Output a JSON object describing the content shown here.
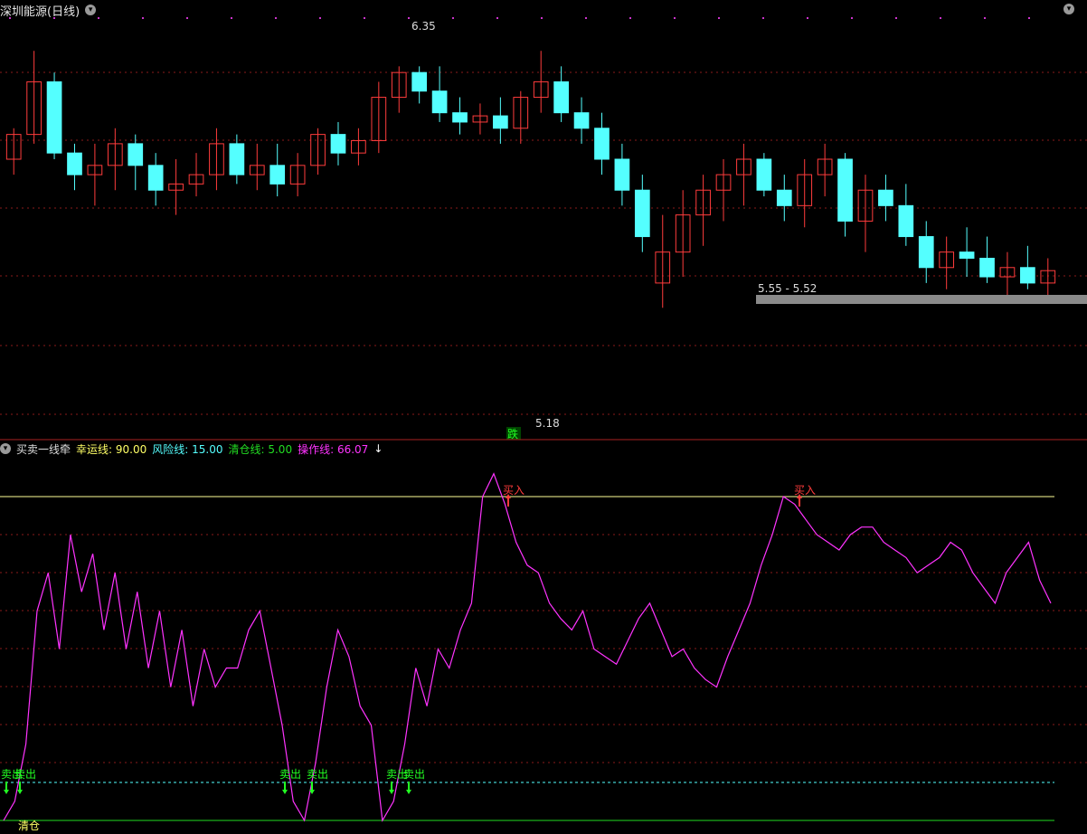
{
  "price_panel": {
    "title": "深圳能源(日线)",
    "high_label": "6.35",
    "low_label": "5.18",
    "zone_label": "5.55 - 5.52",
    "fall_label": "跌"
  },
  "indicator_panel": {
    "name": "买卖一线牵",
    "lucky_label": "幸运线:",
    "lucky_value": "90.00",
    "risk_label": "风险线:",
    "risk_value": "15.00",
    "clear_label": "清仓线:",
    "clear_value": "5.00",
    "op_label": "操作线:",
    "op_value": "66.07",
    "op_arrow": "↓",
    "buy_label": "买入",
    "sell_label": "卖出",
    "clear_signal": "清仓"
  },
  "colors": {
    "up": "#ff3c3c",
    "down": "#54ffff",
    "line": "#ff33ff",
    "lucky": "#ffff66",
    "risk": "#55ffff",
    "clear": "#22dd22",
    "buy": "#ff3c3c",
    "sell": "#22ff22"
  },
  "chart_data": [
    {
      "type": "candlestick",
      "title": "深圳能源(日线)",
      "ylim": [
        5.1,
        6.45
      ],
      "annotations": [
        "6.35",
        "5.18",
        "5.55 - 5.52"
      ],
      "candles": [
        [
          6.0,
          6.1,
          5.95,
          6.08
        ],
        [
          6.08,
          6.35,
          6.05,
          6.25
        ],
        [
          6.25,
          6.28,
          6.0,
          6.02
        ],
        [
          6.02,
          6.05,
          5.9,
          5.95
        ],
        [
          5.95,
          6.05,
          5.85,
          5.98
        ],
        [
          5.98,
          6.1,
          5.9,
          6.05
        ],
        [
          6.05,
          6.08,
          5.9,
          5.98
        ],
        [
          5.98,
          6.02,
          5.85,
          5.9
        ],
        [
          5.9,
          6.0,
          5.82,
          5.92
        ],
        [
          5.92,
          6.02,
          5.88,
          5.95
        ],
        [
          5.95,
          6.1,
          5.9,
          6.05
        ],
        [
          6.05,
          6.08,
          5.92,
          5.95
        ],
        [
          5.95,
          6.05,
          5.9,
          5.98
        ],
        [
          5.98,
          6.05,
          5.88,
          5.92
        ],
        [
          5.92,
          6.02,
          5.88,
          5.98
        ],
        [
          5.98,
          6.1,
          5.95,
          6.08
        ],
        [
          6.08,
          6.12,
          5.98,
          6.02
        ],
        [
          6.02,
          6.1,
          5.98,
          6.06
        ],
        [
          6.06,
          6.25,
          6.02,
          6.2
        ],
        [
          6.2,
          6.3,
          6.15,
          6.28
        ],
        [
          6.28,
          6.3,
          6.18,
          6.22
        ],
        [
          6.22,
          6.3,
          6.12,
          6.15
        ],
        [
          6.15,
          6.2,
          6.08,
          6.12
        ],
        [
          6.12,
          6.18,
          6.08,
          6.14
        ],
        [
          6.14,
          6.2,
          6.05,
          6.1
        ],
        [
          6.1,
          6.22,
          6.05,
          6.2
        ],
        [
          6.2,
          6.35,
          6.15,
          6.25
        ],
        [
          6.25,
          6.3,
          6.12,
          6.15
        ],
        [
          6.15,
          6.2,
          6.05,
          6.1
        ],
        [
          6.1,
          6.15,
          5.95,
          6.0
        ],
        [
          6.0,
          6.05,
          5.85,
          5.9
        ],
        [
          5.9,
          5.95,
          5.7,
          5.75
        ],
        [
          5.6,
          5.82,
          5.52,
          5.7
        ],
        [
          5.7,
          5.9,
          5.62,
          5.82
        ],
        [
          5.82,
          5.95,
          5.72,
          5.9
        ],
        [
          5.9,
          6.0,
          5.8,
          5.95
        ],
        [
          5.95,
          6.05,
          5.85,
          6.0
        ],
        [
          6.0,
          6.02,
          5.88,
          5.9
        ],
        [
          5.9,
          5.95,
          5.8,
          5.85
        ],
        [
          5.85,
          6.0,
          5.78,
          5.95
        ],
        [
          5.95,
          6.05,
          5.88,
          6.0
        ],
        [
          6.0,
          6.02,
          5.75,
          5.8
        ],
        [
          5.8,
          5.95,
          5.7,
          5.9
        ],
        [
          5.9,
          5.95,
          5.8,
          5.85
        ],
        [
          5.85,
          5.92,
          5.72,
          5.75
        ],
        [
          5.75,
          5.8,
          5.6,
          5.65
        ],
        [
          5.65,
          5.75,
          5.58,
          5.7
        ],
        [
          5.7,
          5.78,
          5.62,
          5.68
        ],
        [
          5.68,
          5.75,
          5.6,
          5.62
        ],
        [
          5.62,
          5.7,
          5.55,
          5.65
        ],
        [
          5.65,
          5.72,
          5.58,
          5.6
        ],
        [
          5.6,
          5.68,
          5.55,
          5.64
        ]
      ]
    },
    {
      "type": "line",
      "title": "买卖一线牵",
      "series": [
        {
          "name": "操作线",
          "values": [
            5,
            10,
            25,
            60,
            70,
            50,
            80,
            65,
            75,
            55,
            70,
            50,
            65,
            45,
            60,
            40,
            55,
            35,
            50,
            40,
            45,
            45,
            55,
            60,
            45,
            30,
            10,
            5,
            20,
            40,
            55,
            48,
            35,
            30,
            5,
            10,
            25,
            45,
            35,
            50,
            45,
            55,
            62,
            90,
            96,
            88,
            78,
            72,
            70,
            62,
            58,
            55,
            60,
            50,
            48,
            46,
            52,
            58,
            62,
            55,
            48,
            50,
            45,
            42,
            40,
            48,
            55,
            62,
            72,
            80,
            90,
            88,
            84,
            80,
            78,
            76,
            80,
            82,
            82,
            78,
            76,
            74,
            70,
            72,
            74,
            78,
            76,
            70,
            66,
            62,
            70,
            74,
            78,
            68,
            62
          ]
        }
      ],
      "reference_lines": [
        {
          "name": "幸运线",
          "value": 90
        },
        {
          "name": "风险线",
          "value": 15
        },
        {
          "name": "清仓线",
          "value": 5
        }
      ]
    }
  ]
}
